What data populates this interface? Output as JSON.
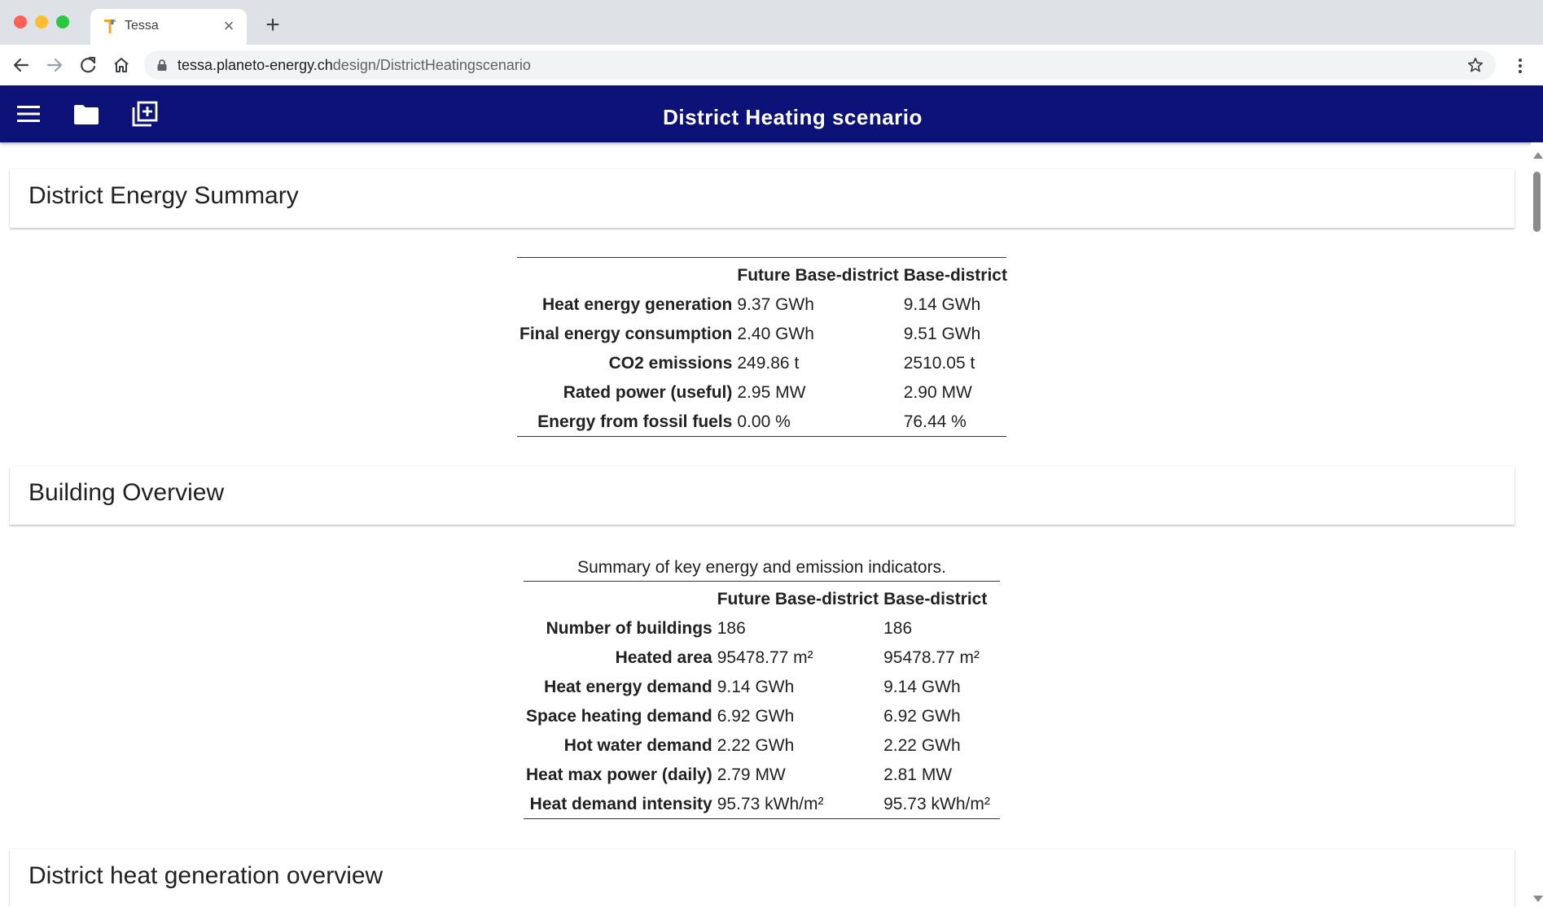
{
  "browser": {
    "tab_title": "Tessa",
    "url_host": "tessa.planeto-energy.ch",
    "url_path": "design/DistrictHeatingscenario",
    "favicon_letter": "T"
  },
  "app": {
    "title": "District Heating scenario"
  },
  "energy_summary": {
    "title": "District Energy Summary",
    "columns": [
      "Future Base-district",
      "Base-district"
    ],
    "rows": [
      {
        "label": "Heat energy generation",
        "future": "9.37 GWh",
        "base": "9.14 GWh"
      },
      {
        "label": "Final energy consumption",
        "future": "2.40 GWh",
        "base": "9.51 GWh"
      },
      {
        "label": "CO2 emissions",
        "future": "249.86 t",
        "base": "2510.05 t"
      },
      {
        "label": "Rated power (useful)",
        "future": "2.95 MW",
        "base": "2.90 MW"
      },
      {
        "label": "Energy from fossil fuels",
        "future": "0.00 %",
        "base": "76.44 %"
      }
    ]
  },
  "building_overview": {
    "title": "Building Overview",
    "caption": "Summary of key energy and emission indicators.",
    "columns": [
      "Future Base-district",
      "Base-district"
    ],
    "rows": [
      {
        "label": "Number of buildings",
        "future": "186",
        "base": "186"
      },
      {
        "label": "Heated area",
        "future": "95478.77 m²",
        "base": "95478.77 m²"
      },
      {
        "label": "Heat energy demand",
        "future": "9.14 GWh",
        "base": "9.14 GWh"
      },
      {
        "label": "Space heating demand",
        "future": "6.92 GWh",
        "base": "6.92 GWh"
      },
      {
        "label": "Hot water demand",
        "future": "2.22 GWh",
        "base": "2.22 GWh"
      },
      {
        "label": "Heat max power (daily)",
        "future": "2.79 MW",
        "base": "2.81 MW"
      },
      {
        "label": "Heat demand intensity",
        "future": "95.73 kWh/m²",
        "base": "95.73 kWh/m²"
      }
    ]
  },
  "heat_generation": {
    "title": "District heat generation overview"
  },
  "colors": {
    "appbar": "#0c1277",
    "favicon": "#f5a623"
  }
}
